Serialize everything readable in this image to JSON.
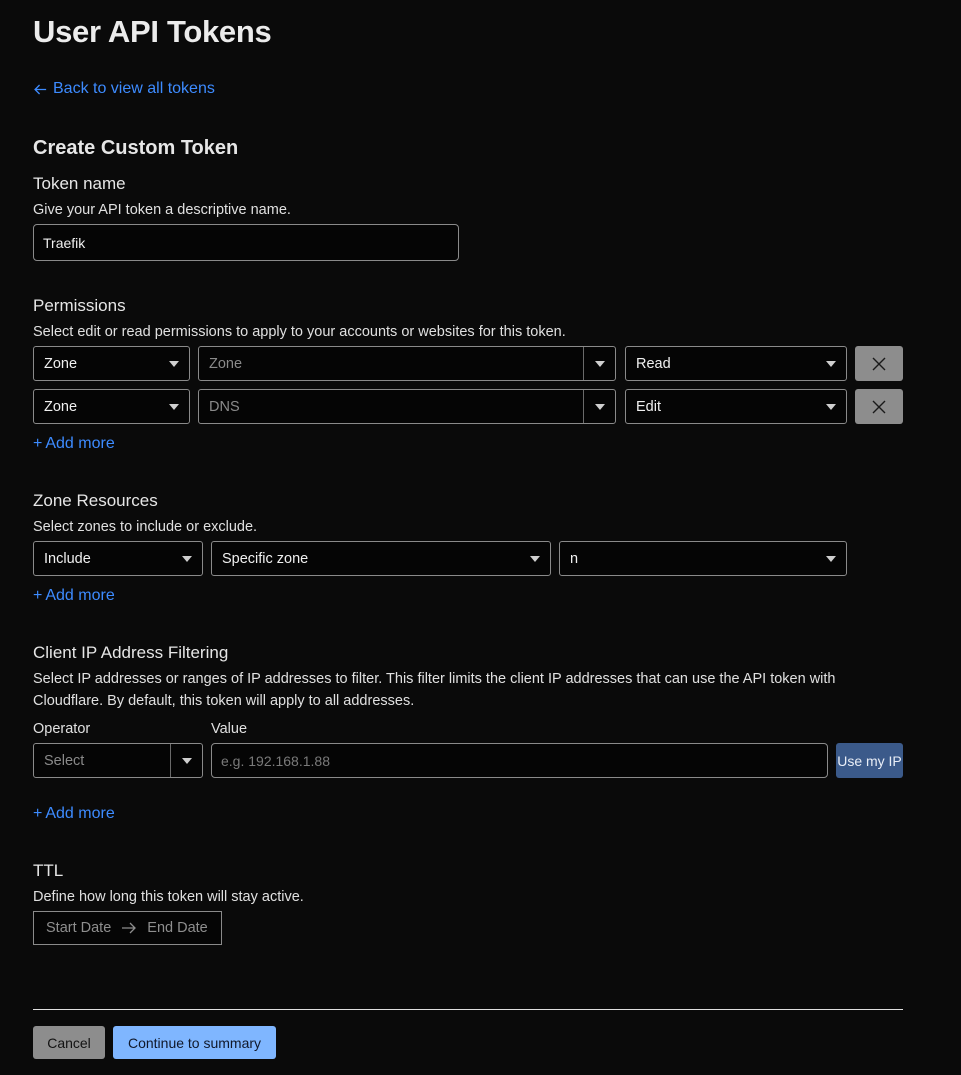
{
  "page_title": "User API Tokens",
  "back_link": "Back to view all tokens",
  "section_title": "Create Custom Token",
  "token_name": {
    "label": "Token name",
    "description": "Give your API token a descriptive name.",
    "value": "Traefik"
  },
  "permissions": {
    "label": "Permissions",
    "description": "Select edit or read permissions to apply to your accounts or websites for this token.",
    "rows": [
      {
        "scope": "Zone",
        "resource": "Zone",
        "level": "Read"
      },
      {
        "scope": "Zone",
        "resource": "DNS",
        "level": "Edit"
      }
    ],
    "add_more": "Add more"
  },
  "zone_resources": {
    "label": "Zone Resources",
    "description": "Select zones to include or exclude.",
    "include": "Include",
    "zone_type": "Specific zone",
    "zone_value": "n",
    "add_more": "Add more"
  },
  "ip_filtering": {
    "label": "Client IP Address Filtering",
    "description": "Select IP addresses or ranges of IP addresses to filter. This filter limits the client IP addresses that can use the API token with Cloudflare. By default, this token will apply to all addresses.",
    "operator_label": "Operator",
    "value_label": "Value",
    "operator_placeholder": "Select",
    "value_placeholder": "e.g. 192.168.1.88",
    "use_my_ip": "Use my IP",
    "add_more": "Add more"
  },
  "ttl": {
    "label": "TTL",
    "description": "Define how long this token will stay active.",
    "start_placeholder": "Start Date",
    "end_placeholder": "End Date"
  },
  "footer": {
    "cancel": "Cancel",
    "continue": "Continue to summary"
  },
  "colors": {
    "background": "#0a0a0a",
    "link": "#3d8bff",
    "primary_button": "#7fb6ff",
    "secondary_button": "#8d8d8d",
    "ip_button": "#3b5a8a"
  }
}
